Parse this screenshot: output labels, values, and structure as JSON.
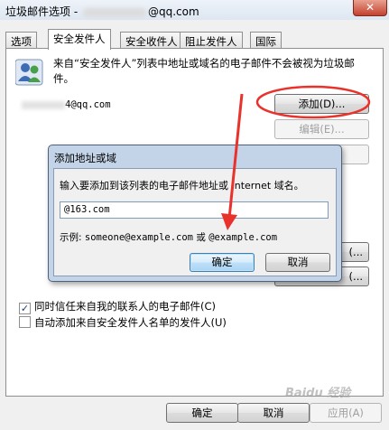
{
  "window": {
    "title_prefix": "垃圾邮件选项 -",
    "title_suffix": "@qq.com",
    "close_glyph": "✕"
  },
  "tabs": [
    {
      "label": "选项"
    },
    {
      "label": "安全发件人"
    },
    {
      "label": "安全收件人"
    },
    {
      "label": "阻止发件人"
    },
    {
      "label": "国际"
    }
  ],
  "panel": {
    "description": "来自“安全发件人”列表中地址或域名的电子邮件不会被视为垃圾邮件。",
    "list_item_suffix": "4@qq.com",
    "buttons": {
      "add": "添加(D)...",
      "edit": "编辑(E)...",
      "third": "",
      "import": "(...",
      "export": "(..."
    },
    "checkbox_trust_contacts": {
      "label": "同时信任来自我的联系人的电子邮件(C)",
      "checked": true
    },
    "checkbox_auto_add": {
      "label": "自动添加来自安全发件人名单的发件人(U)",
      "checked": false
    }
  },
  "dialog": {
    "title": "添加地址或域",
    "prompt": "输入要添加到该列表的电子邮件地址或 Internet 域名。",
    "input_value": "@163.com",
    "example_label": "示例:",
    "example_1": "someone@example.com",
    "example_or": "或",
    "example_2": "@example.com",
    "ok": "确定",
    "cancel": "取消"
  },
  "bottom_buttons": {
    "ok": "确定",
    "cancel": "取消",
    "apply": "应用(A)"
  },
  "watermark": "Baidu 经验",
  "colors": {
    "annotation_red": "#e8322b",
    "title_gradient_top": "#eef3f9",
    "dialog_frame": "#c4d4e8"
  },
  "icons": [
    "people-icon",
    "close-icon",
    "check-icon"
  ]
}
